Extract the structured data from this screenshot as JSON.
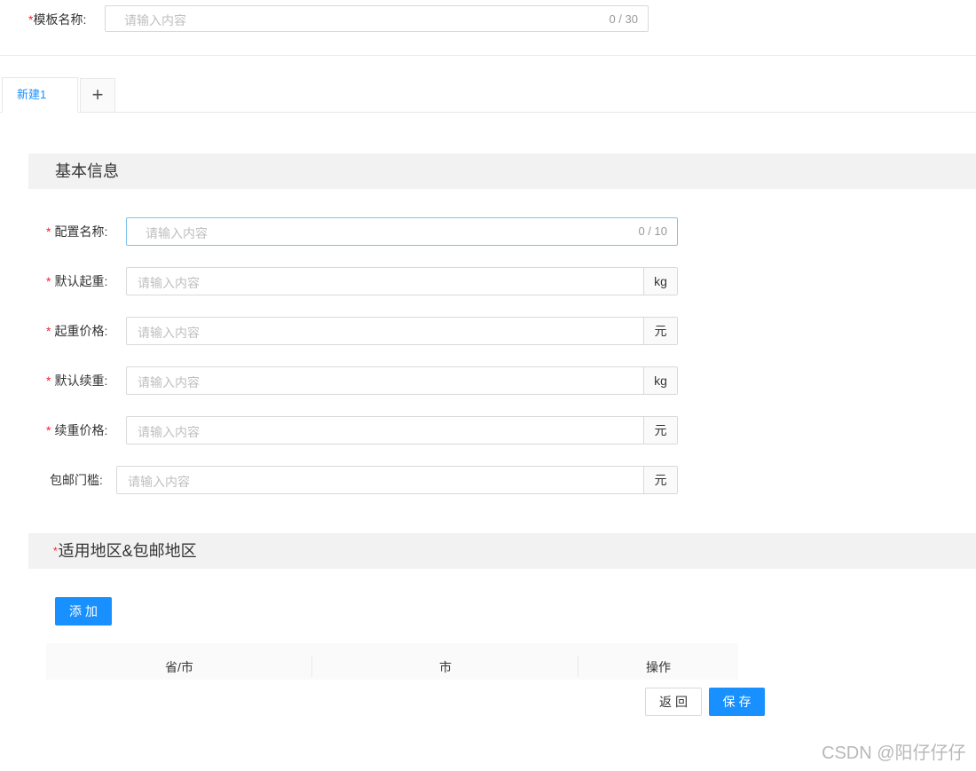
{
  "template": {
    "required_mark": "*",
    "label": "模板名称:",
    "placeholder": "请输入内容",
    "counter": "0 / 30"
  },
  "tabs": [
    {
      "label": "新建1",
      "active": true
    },
    {
      "label": "+",
      "active": false
    }
  ],
  "basic_section": {
    "title": "基本信息"
  },
  "fields": [
    {
      "required": "*",
      "label": "配置名称:",
      "placeholder": "请输入内容",
      "counter": "0 / 10"
    },
    {
      "required": "*",
      "label": "默认起重:",
      "placeholder": "请输入内容",
      "suffix": "kg"
    },
    {
      "required": "*",
      "label": "起重价格:",
      "placeholder": "请输入内容",
      "suffix": "元"
    },
    {
      "required": "*",
      "label": "默认续重:",
      "placeholder": "请输入内容",
      "suffix": "kg"
    },
    {
      "required": "*",
      "label": "续重价格:",
      "placeholder": "请输入内容",
      "suffix": "元"
    },
    {
      "required": "",
      "label": "包邮门槛:",
      "placeholder": "请输入内容",
      "suffix": "元"
    }
  ],
  "area_section": {
    "required_mark": "*",
    "title": "适用地区&包邮地区"
  },
  "add_button": "添加",
  "table": {
    "columns": [
      "省/市",
      "市",
      "操作"
    ]
  },
  "footer": {
    "back_button": "返回",
    "save_button": "保存"
  },
  "watermark": "CSDN @阳仔仔仔",
  "colors": {
    "primary": "#1890ff",
    "required": "#f5222d",
    "section_bg": "#f2f2f2"
  }
}
